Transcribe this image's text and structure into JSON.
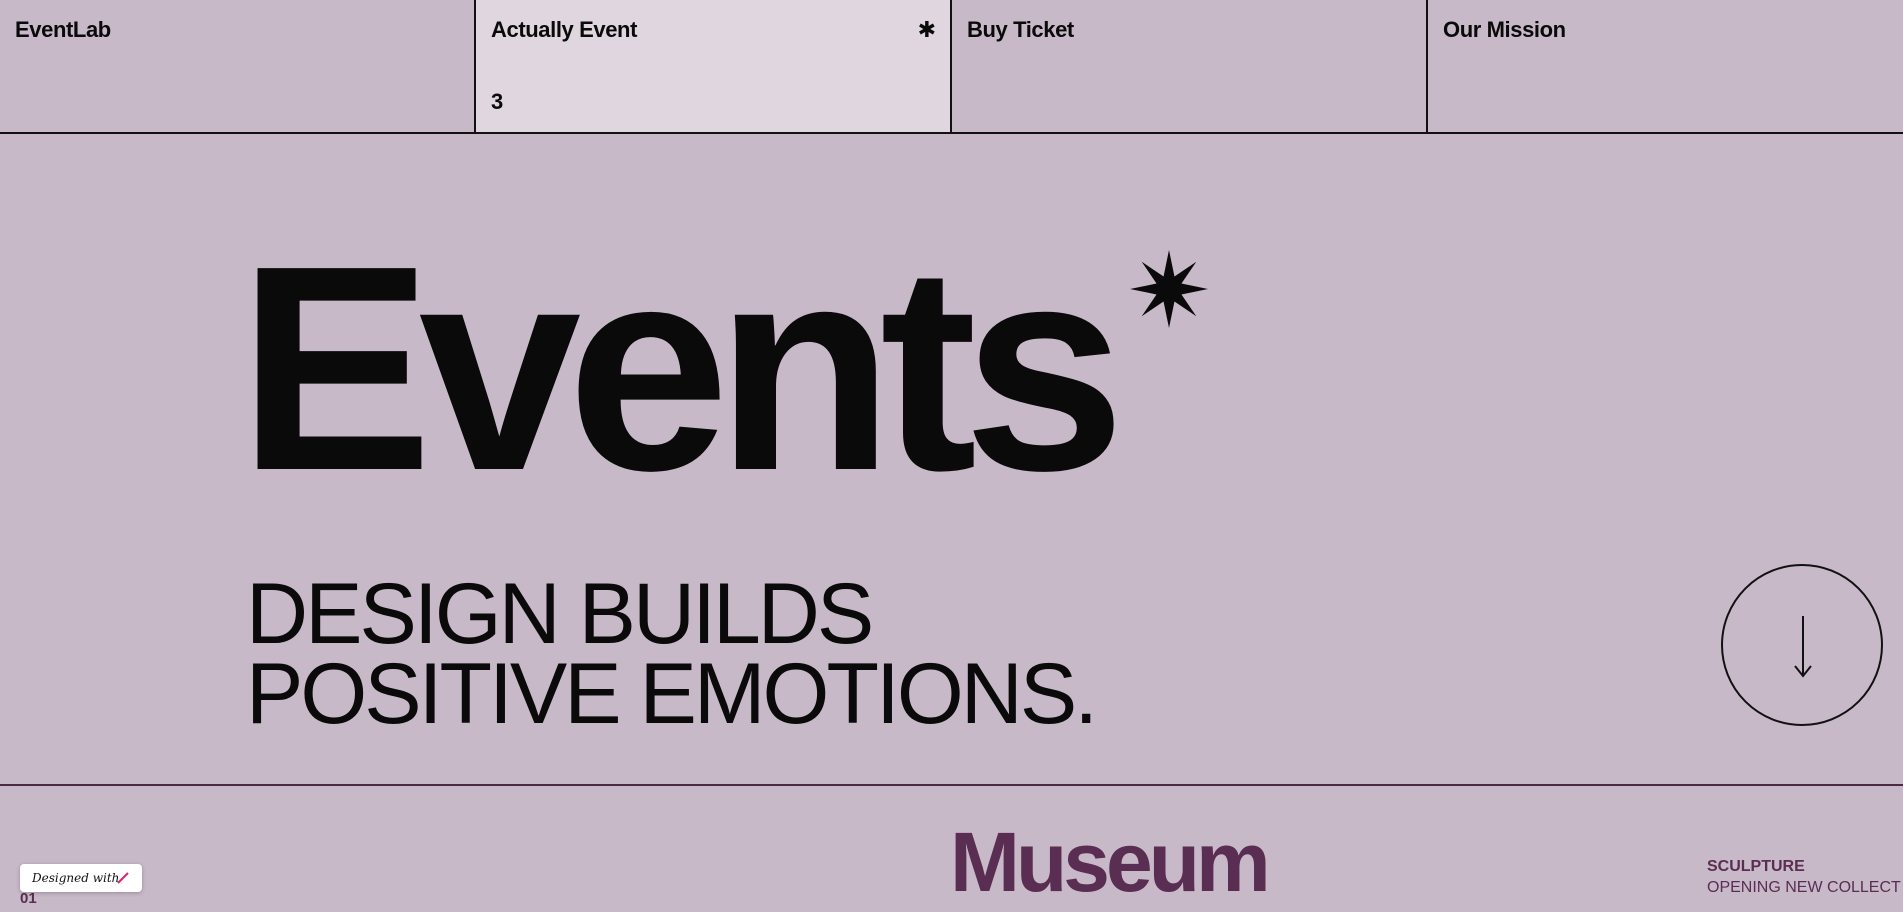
{
  "nav": {
    "items": [
      {
        "label": "EventLab"
      },
      {
        "label": "Actually Event",
        "star": "✱",
        "count": "3"
      },
      {
        "label": "Buy Ticket"
      },
      {
        "label": "Our Mission"
      }
    ]
  },
  "hero": {
    "title": "Events",
    "tagline": [
      "DESIGN BUILDS",
      "POSITIVE EMOTIONS."
    ]
  },
  "next_event": {
    "title": "Museum",
    "category": "SCULPTURE",
    "subtitle": "OPENING NEW COLLECT",
    "index": "01"
  },
  "badge": {
    "label": "Designed with"
  },
  "icons": {
    "hero_star": "eight-point-star-icon",
    "scroll": "arrow-down-icon",
    "badge": "pen-icon"
  },
  "colors": {
    "background": "#c8b9c9",
    "active_nav": "#dfd6e0",
    "accent": "#5a2d52",
    "text": "#0a0a0a"
  }
}
